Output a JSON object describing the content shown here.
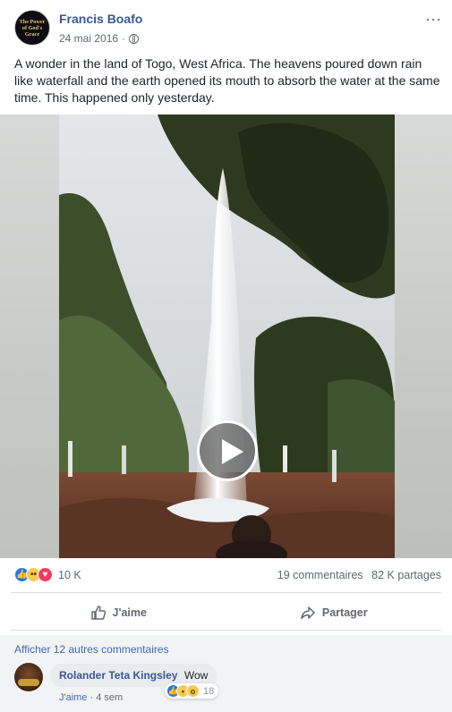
{
  "post": {
    "author": "Francis Boafo",
    "avatar_text": "The Power of God's Grace",
    "date": "24 mai 2016",
    "separator": "·",
    "more_label": "···",
    "text": "A wonder in the land of Togo, West Africa. The heavens poured down rain like waterfall and the earth opened its mouth to absorb the water at the same time. This happened only yesterday."
  },
  "stats": {
    "reaction_count": "10 K",
    "comments": "19 commentaires",
    "shares": "82 K partages"
  },
  "actions": {
    "like": "J'aime",
    "share": "Partager"
  },
  "comments": {
    "more_link": "Afficher 12 autres commentaires",
    "items": [
      {
        "author": "Rolander Teta Kingsley",
        "text": "Wow",
        "like_label": "J'aime",
        "separator": "·",
        "age": "4 sem",
        "reaction_count": "18"
      }
    ]
  },
  "colors": {
    "link": "#385898",
    "like_blue": "#2078f4",
    "love_red": "#f23b5c",
    "wow_yellow": "#f7c94c"
  },
  "icons": [
    "globe-icon",
    "more-icon",
    "play-icon",
    "like-reaction-icon",
    "wow-reaction-icon",
    "love-reaction-icon",
    "haha-reaction-icon",
    "thumbs-up-icon",
    "share-arrow-icon"
  ]
}
